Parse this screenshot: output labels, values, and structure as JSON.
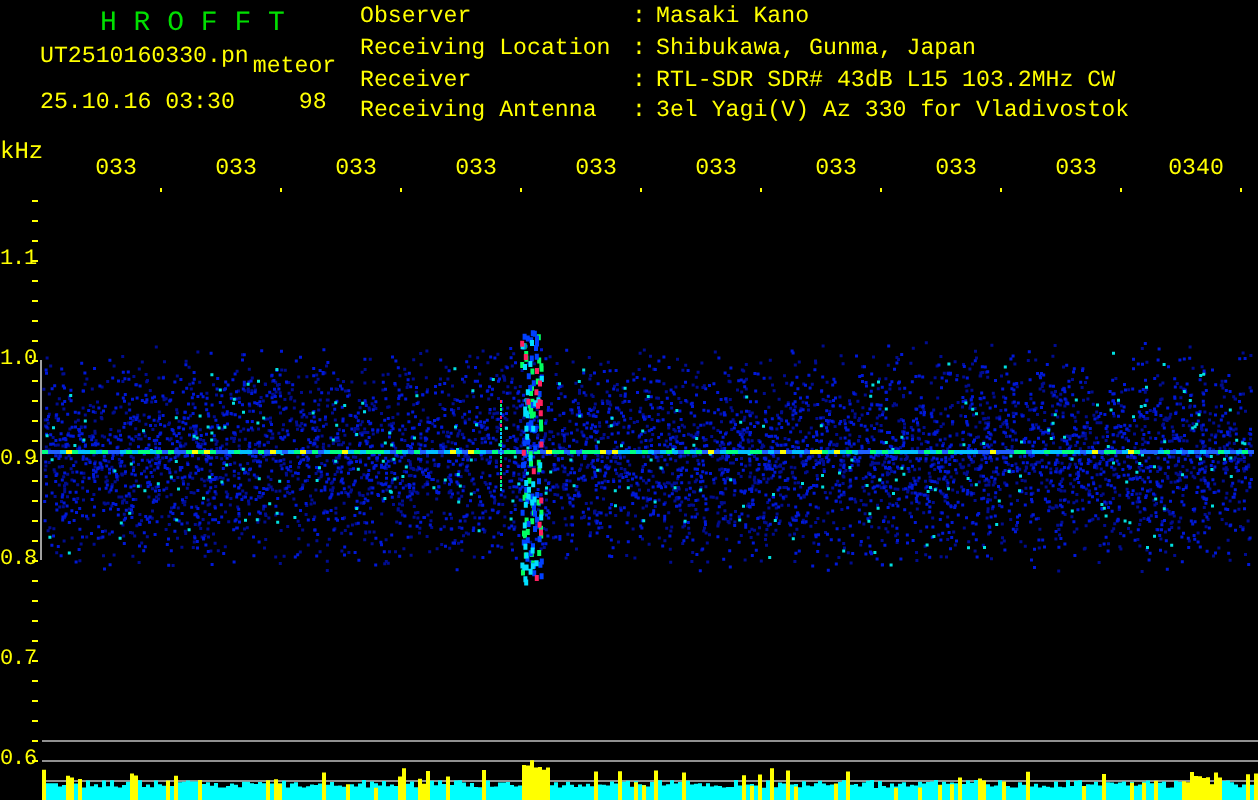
{
  "app": {
    "title": "H R O F F T"
  },
  "file": {
    "name": "UT2510160330.pn",
    "mode": "meteor",
    "datetime": "25.10.16 03:30",
    "value": "98"
  },
  "info": [
    {
      "label": "Observer",
      "separator": ":",
      "value": "Masaki Kano"
    },
    {
      "label": "Receiving Location",
      "separator": ":",
      "value": "Shibukawa, Gunma, Japan"
    },
    {
      "label": "Receiver",
      "separator": ":",
      "value": "RTL-SDR SDR# 43dB L15 103.2MHz CW"
    },
    {
      "label": "Receiving Antenna",
      "separator": ":",
      "value": "3el Yagi(V) Az 330 for Vladivostok"
    }
  ],
  "plot": {
    "unit": "kHz",
    "time_labels": [
      "033",
      "033",
      "033",
      "033",
      "033",
      "033",
      "033",
      "033",
      "033",
      "0340"
    ],
    "freq_labels": [
      "1.1",
      "1.0",
      "0.9",
      "0.8",
      "0.7",
      "0.6"
    ]
  }
}
